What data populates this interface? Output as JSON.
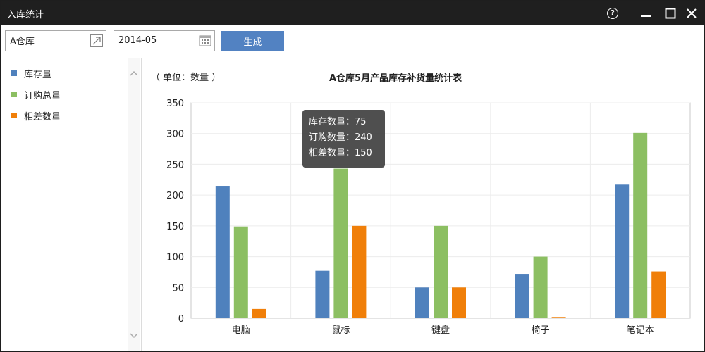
{
  "window": {
    "title": "入库统计"
  },
  "toolbar": {
    "warehouse_value": "A仓库",
    "date_value": "2014-05",
    "generate_label": "生成"
  },
  "chart": {
    "unit_label": "（ 单位：数量 ）",
    "title": "A仓库5月产品库存补货量统计表"
  },
  "tooltip": {
    "lines": [
      "库存数量：75",
      "订购数量：240",
      "相差数量：150"
    ]
  },
  "chart_data": {
    "type": "bar",
    "title": "A仓库5月产品库存补货量统计表",
    "ylabel": "（ 单位：数量 ）",
    "categories": [
      "电脑",
      "鼠标",
      "键盘",
      "椅子",
      "笔记本"
    ],
    "series": [
      {
        "name": "库存量",
        "color": "#4f81bd",
        "values": [
          215,
          77,
          50,
          72,
          217
        ]
      },
      {
        "name": "订购总量",
        "color": "#8cbf62",
        "values": [
          149,
          243,
          150,
          100,
          301
        ]
      },
      {
        "name": "相差数量",
        "color": "#f07f09",
        "values": [
          15,
          150,
          50,
          2,
          76
        ]
      }
    ],
    "ylim": [
      0,
      350
    ],
    "yticks": [
      0,
      50,
      100,
      150,
      200,
      250,
      300,
      350
    ],
    "grid": true,
    "legend_position": "left-sidebar"
  }
}
